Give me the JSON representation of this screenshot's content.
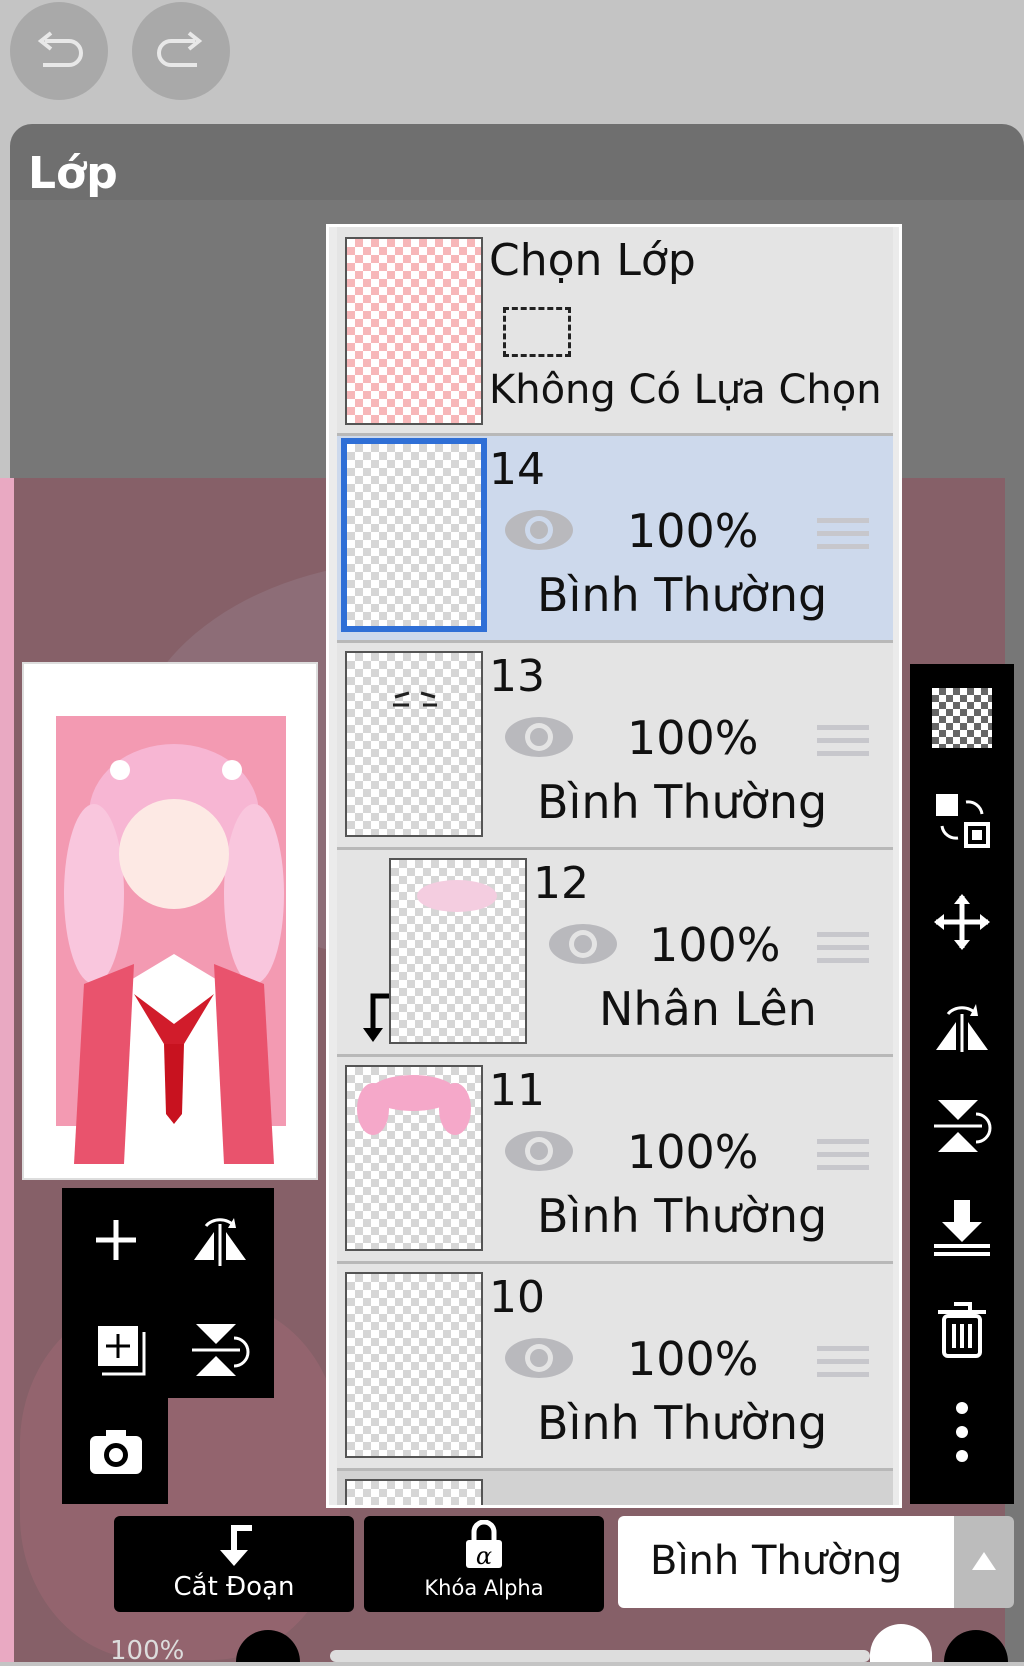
{
  "panel": {
    "title": "Lớp"
  },
  "top": {
    "undo_icon": "undo-icon",
    "redo_icon": "redo-icon"
  },
  "selection_layer": {
    "title": "Chọn Lớp",
    "status": "Không Có Lựa Chọn"
  },
  "layers": [
    {
      "name": "14",
      "opacity": "100%",
      "blend": "Bình Thường",
      "selected": true
    },
    {
      "name": "13",
      "opacity": "100%",
      "blend": "Bình Thường"
    },
    {
      "name": "12",
      "opacity": "100%",
      "blend": "Nhân Lên",
      "clipped": true
    },
    {
      "name": "11",
      "opacity": "100%",
      "blend": "Bình Thường"
    },
    {
      "name": "10",
      "opacity": "100%",
      "blend": "Bình Thường"
    }
  ],
  "bottom": {
    "clip_label": "Cắt Đoạn",
    "alpha_label": "Khóa Alpha",
    "blend_mode": "Bình Thường",
    "opacity_readout": "100%"
  },
  "colors": {
    "selected_row": "#cdd9ec",
    "selection_border": "#2f6fd6",
    "toolbar": "#000000"
  }
}
